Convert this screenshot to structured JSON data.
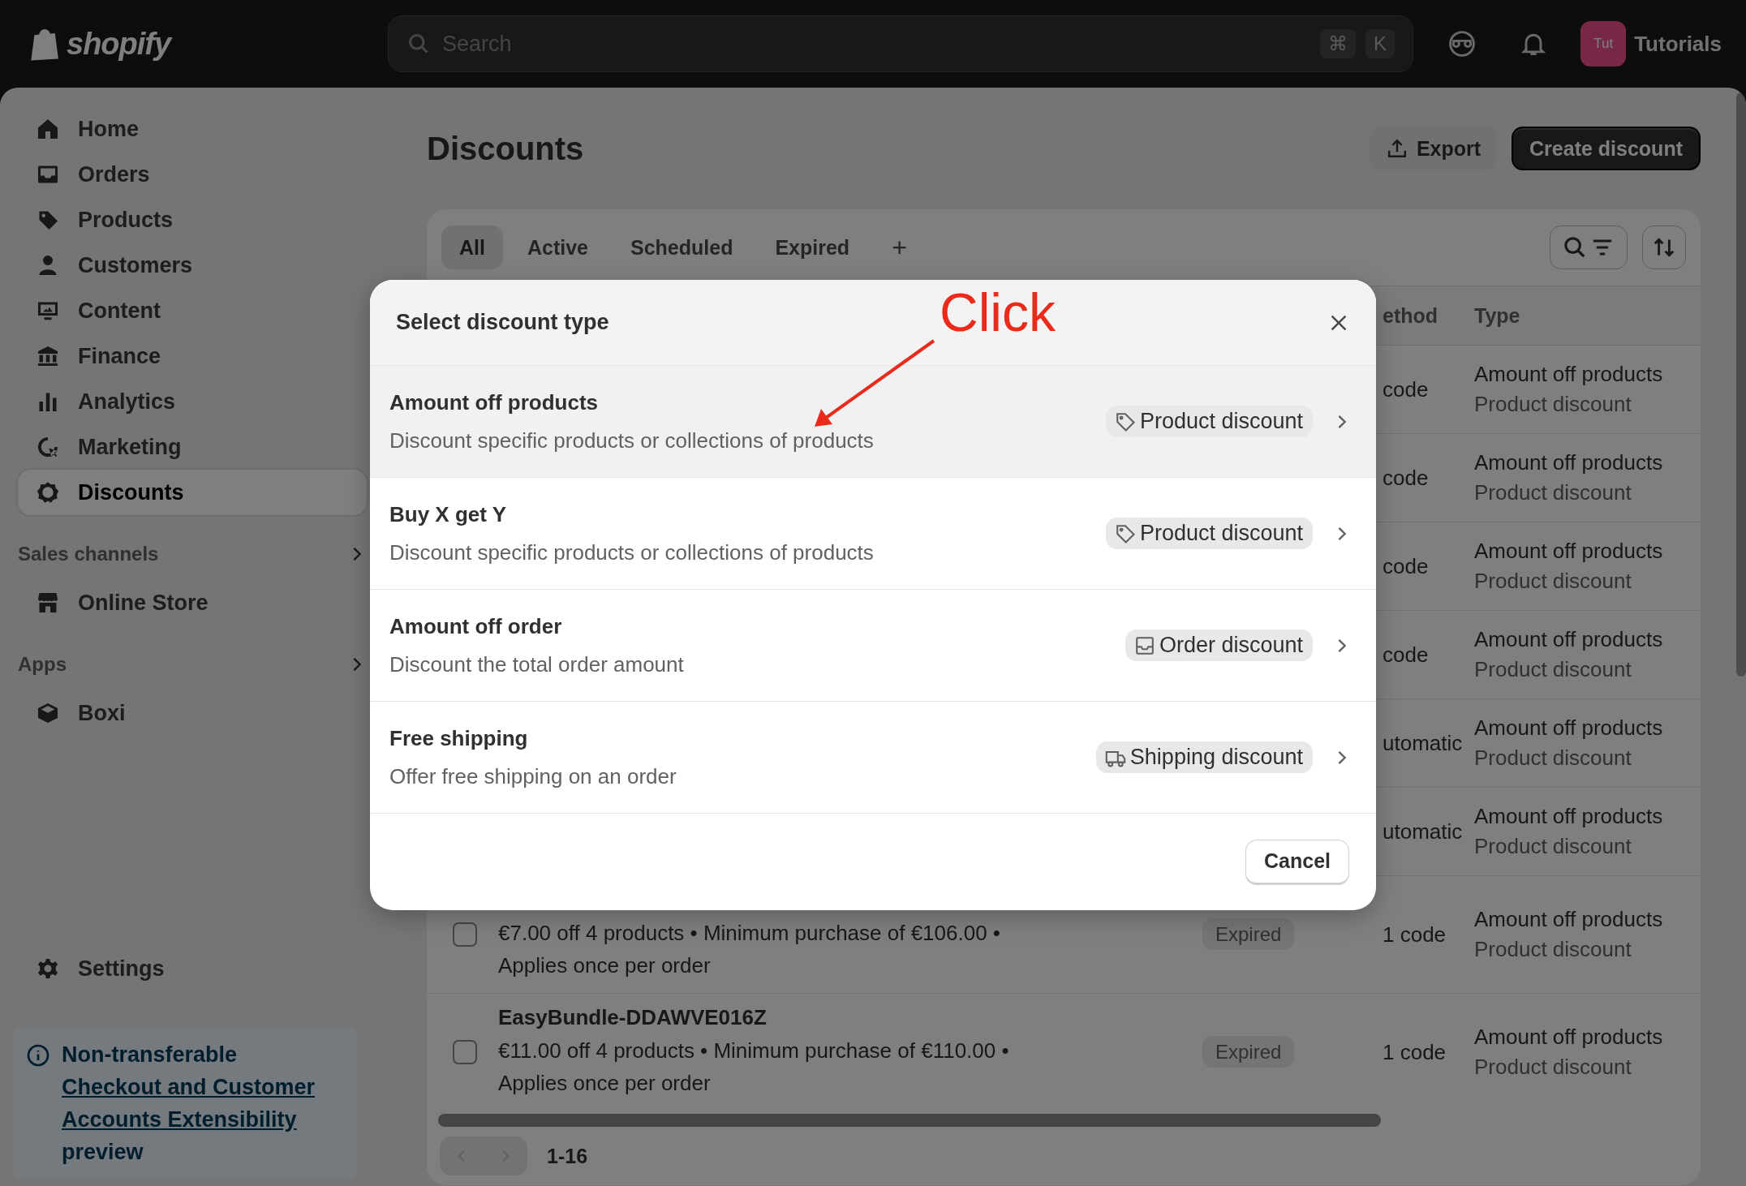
{
  "topbar": {
    "logo_text": "shopify",
    "search": {
      "placeholder": "Search",
      "shortcut_keys": [
        "⌘",
        "K"
      ]
    },
    "store": {
      "avatar_initials": "Tut",
      "name": "Tutorials"
    }
  },
  "sidebar": {
    "items": [
      {
        "label": "Home",
        "selected": false
      },
      {
        "label": "Orders",
        "selected": false
      },
      {
        "label": "Products",
        "selected": false
      },
      {
        "label": "Customers",
        "selected": false
      },
      {
        "label": "Content",
        "selected": false
      },
      {
        "label": "Finance",
        "selected": false
      },
      {
        "label": "Analytics",
        "selected": false
      },
      {
        "label": "Marketing",
        "selected": false
      },
      {
        "label": "Discounts",
        "selected": true
      }
    ],
    "sections": [
      {
        "heading": "Sales channels",
        "items": [
          {
            "label": "Online Store"
          }
        ]
      },
      {
        "heading": "Apps",
        "items": [
          {
            "label": "Boxi"
          }
        ]
      }
    ],
    "settings": {
      "label": "Settings"
    },
    "notice": {
      "prefix": "Non-transferable",
      "link": "Checkout and Customer Accounts Extensibility",
      "suffix": "preview"
    }
  },
  "page": {
    "title": "Discounts",
    "buttons": [
      {
        "label": "Export",
        "kind": "secondary"
      },
      {
        "label": "Create discount",
        "kind": "primary"
      }
    ]
  },
  "table": {
    "tabs": [
      {
        "label": "All",
        "selected": true
      },
      {
        "label": "Active",
        "selected": false
      },
      {
        "label": "Scheduled",
        "selected": false
      },
      {
        "label": "Expired",
        "selected": false
      }
    ],
    "add_tab": "+",
    "columns": [
      {
        "label": "ethod"
      },
      {
        "label": "Type"
      }
    ],
    "rows": [
      {
        "method": "code",
        "type": "Amount off products",
        "type_detail": "Product discount"
      },
      {
        "method": "code",
        "type": "Amount off products",
        "type_detail": "Product discount"
      },
      {
        "method": "code",
        "type": "Amount off products",
        "type_detail": "Product discount"
      },
      {
        "method": "code",
        "type": "Amount off products",
        "type_detail": "Product discount"
      },
      {
        "method": "utomatic",
        "type": "Amount off products",
        "type_detail": "Product discount"
      },
      {
        "method": "utomatic",
        "type": "Amount off products",
        "type_detail": "Product discount"
      },
      {
        "checked": false,
        "description": "€7.00 off 4 products • Minimum purchase of €106.00 • Applies once per order",
        "status": "Expired",
        "method": "1 code",
        "type": "Amount off products",
        "type_detail": "Product discount"
      },
      {
        "checked": false,
        "title": "EasyBundle-DDAWVE016Z",
        "description": "€11.00 off 4 products • Minimum purchase of €110.00 • Applies once per order",
        "status": "Expired",
        "method": "1 code",
        "type": "Amount off products",
        "type_detail": "Product discount"
      }
    ],
    "pagination": {
      "range": "1-16",
      "previous_disabled": true,
      "next_disabled": true
    }
  },
  "modal": {
    "title": "Select discount type",
    "options": [
      {
        "title": "Amount off products",
        "description": "Discount specific products or collections of products",
        "badge": "Product discount",
        "kind": "product",
        "highlighted": true
      },
      {
        "title": "Buy X get Y",
        "description": "Discount specific products or collections of products",
        "badge": "Product discount",
        "kind": "product",
        "highlighted": false
      },
      {
        "title": "Amount off order",
        "description": "Discount the total order amount",
        "badge": "Order discount",
        "kind": "order",
        "highlighted": false
      },
      {
        "title": "Free shipping",
        "description": "Offer free shipping on an order",
        "badge": "Shipping discount",
        "kind": "shipping",
        "highlighted": false
      }
    ],
    "cancel": "Cancel"
  },
  "annotation": {
    "text": "Click"
  }
}
